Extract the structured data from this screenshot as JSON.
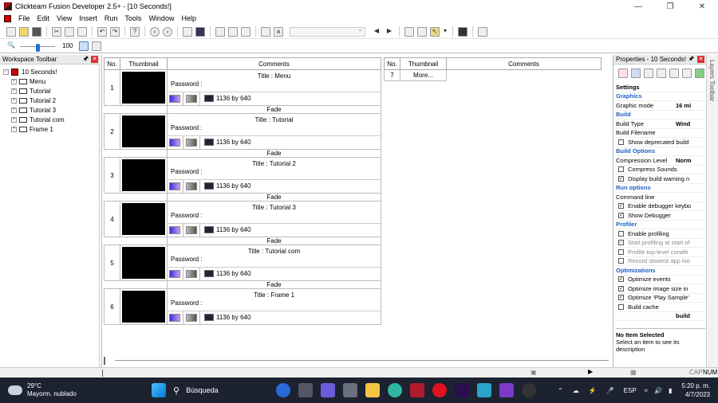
{
  "window": {
    "title": "Clickteam Fusion Developer 2.5+ - [10 Seconds!]"
  },
  "menu": [
    "File",
    "Edit",
    "View",
    "Insert",
    "Run",
    "Tools",
    "Window",
    "Help"
  ],
  "toolbar": {
    "zoom_value": "100"
  },
  "workspace": {
    "title": "Workspace Toolbar",
    "app_name": "10 Seconds!",
    "frames": [
      "Menu",
      "Tutorial",
      "Tutorial 2",
      "Tutorial 3",
      "Tutorial com",
      "Frame 1"
    ]
  },
  "storyboard": {
    "headers": {
      "no": "No.",
      "thumbnail": "Thumbnail",
      "comments": "Comments"
    },
    "title_label": "Title :",
    "password_label": "Password :",
    "transition": "Fade",
    "rows": [
      {
        "no": "1",
        "title": "Menu",
        "size": "1136 by 640"
      },
      {
        "no": "2",
        "title": "Tutorial",
        "size": "1136 by 640"
      },
      {
        "no": "3",
        "title": "Tutorial 2",
        "size": "1136 by 640"
      },
      {
        "no": "4",
        "title": "Tutorial 3",
        "size": "1136 by 640"
      },
      {
        "no": "5",
        "title": "Tutorial com",
        "size": "1136 by 640"
      },
      {
        "no": "6",
        "title": "Frame 1",
        "size": "1136 by 640"
      }
    ],
    "extra_row": {
      "no": "7",
      "more": "More..."
    }
  },
  "properties": {
    "title": "Properties - 10 Seconds!",
    "rows": [
      {
        "type": "hdr",
        "label": "Settings"
      },
      {
        "type": "sec",
        "label": "Graphics"
      },
      {
        "type": "val",
        "label": "Graphic mode",
        "value": "16 mi"
      },
      {
        "type": "sec",
        "label": "Build"
      },
      {
        "type": "val",
        "label": "Build Type",
        "value": "Wind"
      },
      {
        "type": "val",
        "label": "Build Filename",
        "value": ""
      },
      {
        "type": "chk",
        "label": "Show deprecated build",
        "checked": false
      },
      {
        "type": "sec",
        "label": "Build Options"
      },
      {
        "type": "val",
        "label": "Compression Level",
        "value": "Norm"
      },
      {
        "type": "chk",
        "label": "Compress Sounds",
        "checked": false
      },
      {
        "type": "chk",
        "label": "Display build warning n",
        "checked": true
      },
      {
        "type": "sec",
        "label": "Run options"
      },
      {
        "type": "val",
        "label": "Command line",
        "value": ""
      },
      {
        "type": "chk",
        "label": "Enable debugger keybo",
        "checked": true
      },
      {
        "type": "chk",
        "label": "Show Debugger",
        "checked": true
      },
      {
        "type": "sec",
        "label": "Profiler"
      },
      {
        "type": "chk",
        "label": "Enable profiling",
        "checked": false
      },
      {
        "type": "chk",
        "label": "Start profiling at start of",
        "checked": true,
        "disabled": true
      },
      {
        "type": "chk",
        "label": "Profile top-level conditi",
        "checked": false,
        "disabled": true
      },
      {
        "type": "chk",
        "label": "Record slowest app loo",
        "checked": false,
        "disabled": true
      },
      {
        "type": "sec",
        "label": "Optimizations"
      },
      {
        "type": "chk",
        "label": "Optimize events",
        "checked": true
      },
      {
        "type": "chk",
        "label": "Optimize image size in",
        "checked": true
      },
      {
        "type": "chk",
        "label": "Optimize 'Play Sample'",
        "checked": true
      },
      {
        "type": "chk",
        "label": "Build cache",
        "checked": false
      },
      {
        "type": "val",
        "label": "",
        "value": "build"
      }
    ],
    "desc_title": "No Item Selected",
    "desc_text": "Select an item to see its description"
  },
  "layers": {
    "label": "Layers Toolbar"
  },
  "status": {
    "caps": "CAP",
    "num": "NUM"
  },
  "taskbar": {
    "temp": "29°C",
    "weather": "Mayorm. nublado",
    "search": "Búsqueda",
    "lang": "ESP",
    "time": "5:20 p. m.",
    "date": "4/7/2023"
  }
}
